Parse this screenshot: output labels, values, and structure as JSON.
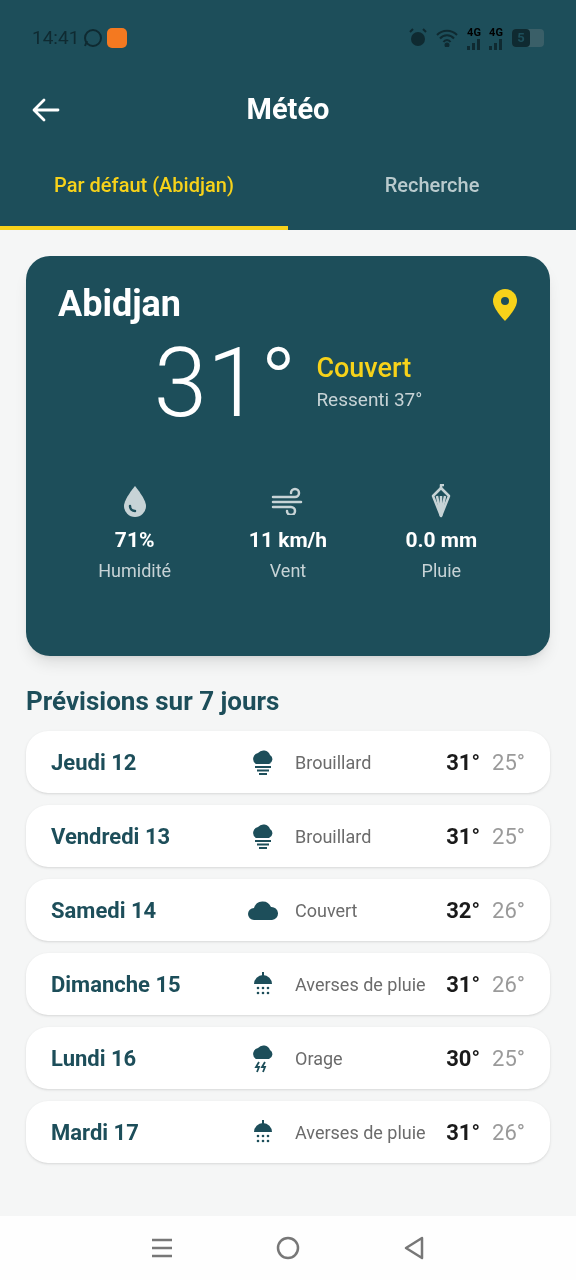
{
  "status_bar": {
    "time": "14:41",
    "network_1": "4G",
    "network_2": "4G",
    "battery": "5"
  },
  "app_bar": {
    "title": "Météo"
  },
  "tabs": [
    {
      "label": "Par défaut (Abidjan)",
      "selected": true
    },
    {
      "label": "Recherche",
      "selected": false
    }
  ],
  "current": {
    "city": "Abidjan",
    "temperature": "31°",
    "condition": "Couvert",
    "feels_like": "Ressenti 37°",
    "stats": [
      {
        "kind": "humidity",
        "value": "71%",
        "label": "Humidité"
      },
      {
        "kind": "wind",
        "value": "11 km/h",
        "label": "Vent"
      },
      {
        "kind": "rain",
        "value": "0.0 mm",
        "label": "Pluie"
      }
    ]
  },
  "forecast": {
    "title": "Prévisions sur 7 jours",
    "days": [
      {
        "day": "Jeudi 12",
        "kind": "fog",
        "condition": "Brouillard",
        "high": "31°",
        "low": "25°"
      },
      {
        "day": "Vendredi 13",
        "kind": "fog",
        "condition": "Brouillard",
        "high": "31°",
        "low": "25°"
      },
      {
        "day": "Samedi 14",
        "kind": "cloud",
        "condition": "Couvert",
        "high": "32°",
        "low": "26°"
      },
      {
        "day": "Dimanche 15",
        "kind": "showers",
        "condition": "Averses de pluie",
        "high": "31°",
        "low": "26°"
      },
      {
        "day": "Lundi 16",
        "kind": "storm",
        "condition": "Orage",
        "high": "30°",
        "low": "25°"
      },
      {
        "day": "Mardi 17",
        "kind": "showers",
        "condition": "Averses de pluie",
        "high": "31°",
        "low": "26°"
      }
    ]
  }
}
